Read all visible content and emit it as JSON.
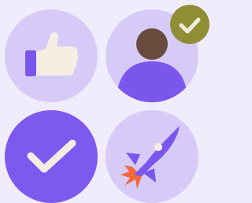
{
  "colors": {
    "background": "#f1ecfb",
    "tile_light": "#d6cbf7",
    "tile_accent": "#7d59ef",
    "purple": "#7b56ec",
    "cream": "#f7eee3",
    "skin": "#6b4a3e",
    "badge": "#8f8e35",
    "flame": "#f26a3c",
    "check_light": "#f3ece1"
  },
  "icons": [
    {
      "name": "thumbs-up-icon",
      "label": ""
    },
    {
      "name": "user-avatar-icon",
      "label": ""
    },
    {
      "name": "checkmark-icon",
      "label": ""
    },
    {
      "name": "rocket-icon",
      "label": ""
    }
  ],
  "badge": {
    "name": "verified-check-badge-icon"
  }
}
